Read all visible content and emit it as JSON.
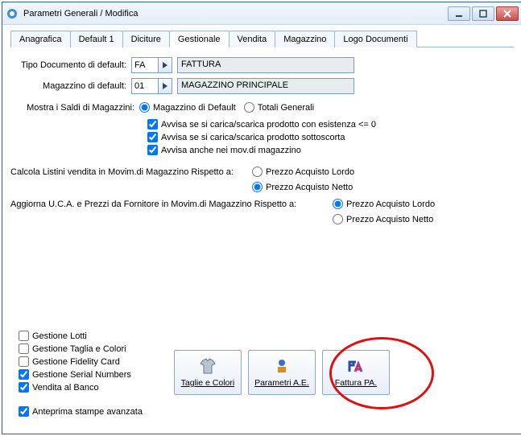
{
  "window": {
    "title": "Parametri Generali / Modifica"
  },
  "tabs": [
    "Anagrafica",
    "Default 1",
    "Diciture",
    "Gestionale",
    "Vendita",
    "Magazzino",
    "Logo Documenti"
  ],
  "tab_active_index": 3,
  "doc": {
    "tipo_label": "Tipo Documento di default:",
    "tipo_code": "FA",
    "tipo_desc": "FATTURA",
    "mag_label": "Magazzino di default:",
    "mag_code": "01",
    "mag_desc": "MAGAZZINO PRINCIPALE"
  },
  "saldi": {
    "label": "Mostra i Saldi di Magazzini:",
    "opt1": "Magazzino di Default",
    "opt2": "Totali Generali",
    "selected": 0
  },
  "avvisi": {
    "a1": "Avvisa se si carica/scarica prodotto con esistenza <= 0",
    "a2": "Avvisa se si carica/scarica prodotto sottoscorta",
    "a3": "Avvisa anche nei mov.di magazzino",
    "c1": true,
    "c2": true,
    "c3": true
  },
  "listini": {
    "label": "Calcola Listini vendita in Movim.di Magazzino Rispetto a:",
    "opt1": "Prezzo Acquisto Lordo",
    "opt2": "Prezzo Acquisto Netto",
    "selected": 1
  },
  "uca": {
    "label": "Aggiorna U.C.A. e Prezzi da  Fornitore in Movim.di Magazzino Rispetto a:",
    "opt1": "Prezzo Acquisto Lordo",
    "opt2": "Prezzo Acquisto Netto",
    "selected": 0
  },
  "checks": {
    "lotti": {
      "label": "Gestione Lotti",
      "checked": false
    },
    "taglia": {
      "label": "Gestione Taglia e Colori",
      "checked": false
    },
    "fidelity": {
      "label": "Gestione Fidelity Card",
      "checked": false
    },
    "serial": {
      "label": "Gestione Serial Numbers",
      "checked": true
    },
    "banco": {
      "label": "Vendita al Banco",
      "checked": true
    }
  },
  "buttons": {
    "taglie": "Taglie e Colori",
    "parametri": "Parametri A.E.",
    "fattura": "Fattura PA."
  },
  "anteprima": {
    "label": "Anteprima stampe avanzata",
    "checked": true
  }
}
